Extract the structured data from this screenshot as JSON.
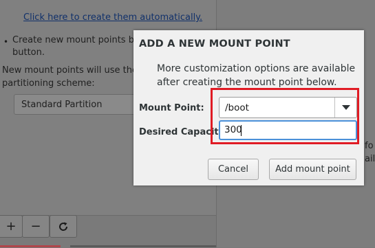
{
  "background": {
    "auto_create_link": "Click here to create them automatically.",
    "bullet_line1": "Create new mount points by c",
    "bullet_line2": "button.",
    "scheme_line1": "New mount points will use the f",
    "scheme_line2": "partitioning scheme:",
    "scheme_value": "Standard Partition",
    "right_text1": "fo",
    "right_text2": "ails",
    "toolbar": {
      "add_icon": "plus-icon",
      "remove_icon": "minus-icon",
      "refresh_icon": "refresh-icon"
    }
  },
  "dialog": {
    "title": "ADD A NEW MOUNT POINT",
    "info_text": "More customization options are available after creating the mount point below.",
    "mount_point_label": "Mount Point:",
    "mount_point_value": "/boot",
    "capacity_label": "Desired Capacity:",
    "capacity_value": "300",
    "cancel_label": "Cancel",
    "add_label": "Add mount point"
  },
  "colors": {
    "highlight": "#e01b24",
    "focus": "#4a90d9",
    "dialog_bg": "#f0f0f0"
  }
}
